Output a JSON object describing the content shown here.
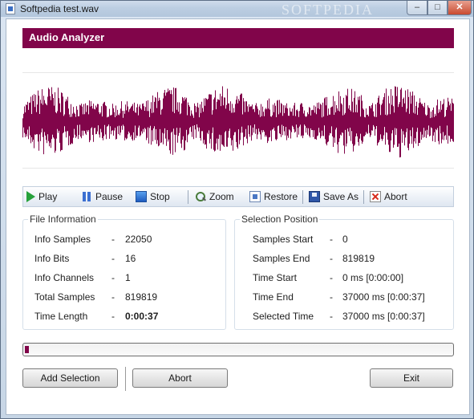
{
  "window": {
    "title": "Softpedia test.wav",
    "watermark": "SOFTPEDIA",
    "controls": {
      "minimize": "–",
      "maximize": "□",
      "close": "✕"
    }
  },
  "header": {
    "title": "Audio Analyzer"
  },
  "waveform": {
    "color": "#81054a"
  },
  "toolbar": {
    "play": "Play",
    "pause": "Pause",
    "stop": "Stop",
    "zoom": "Zoom",
    "restore": "Restore",
    "save_as": "Save As",
    "abort": "Abort"
  },
  "file_info": {
    "title": "File Information",
    "rows": [
      {
        "label": "Info Samples",
        "sep": "-",
        "value": "22050"
      },
      {
        "label": "Info Bits",
        "sep": "-",
        "value": "16"
      },
      {
        "label": "Info Channels",
        "sep": "-",
        "value": "1"
      },
      {
        "label": "Total Samples",
        "sep": "-",
        "value": "819819"
      },
      {
        "label": "Time Length",
        "sep": "-",
        "value": "0:00:37"
      }
    ]
  },
  "selection": {
    "title": "Selection Position",
    "rows": [
      {
        "label": "Samples Start",
        "sep": "-",
        "value": "0"
      },
      {
        "label": "Samples End",
        "sep": "-",
        "value": "819819"
      },
      {
        "label": "Time Start",
        "sep": "-",
        "value": "0 ms [0:00:00]"
      },
      {
        "label": "Time End",
        "sep": "-",
        "value": "37000 ms [0:00:37]"
      },
      {
        "label": "Selected Time",
        "sep": "-",
        "value": "37000 ms [0:00:37]"
      }
    ]
  },
  "progress": {
    "fraction": 0.01,
    "color": "#81054a"
  },
  "buttons": {
    "add_selection": "Add Selection",
    "abort": "Abort",
    "exit": "Exit"
  },
  "colors": {
    "accent": "#81054a"
  }
}
